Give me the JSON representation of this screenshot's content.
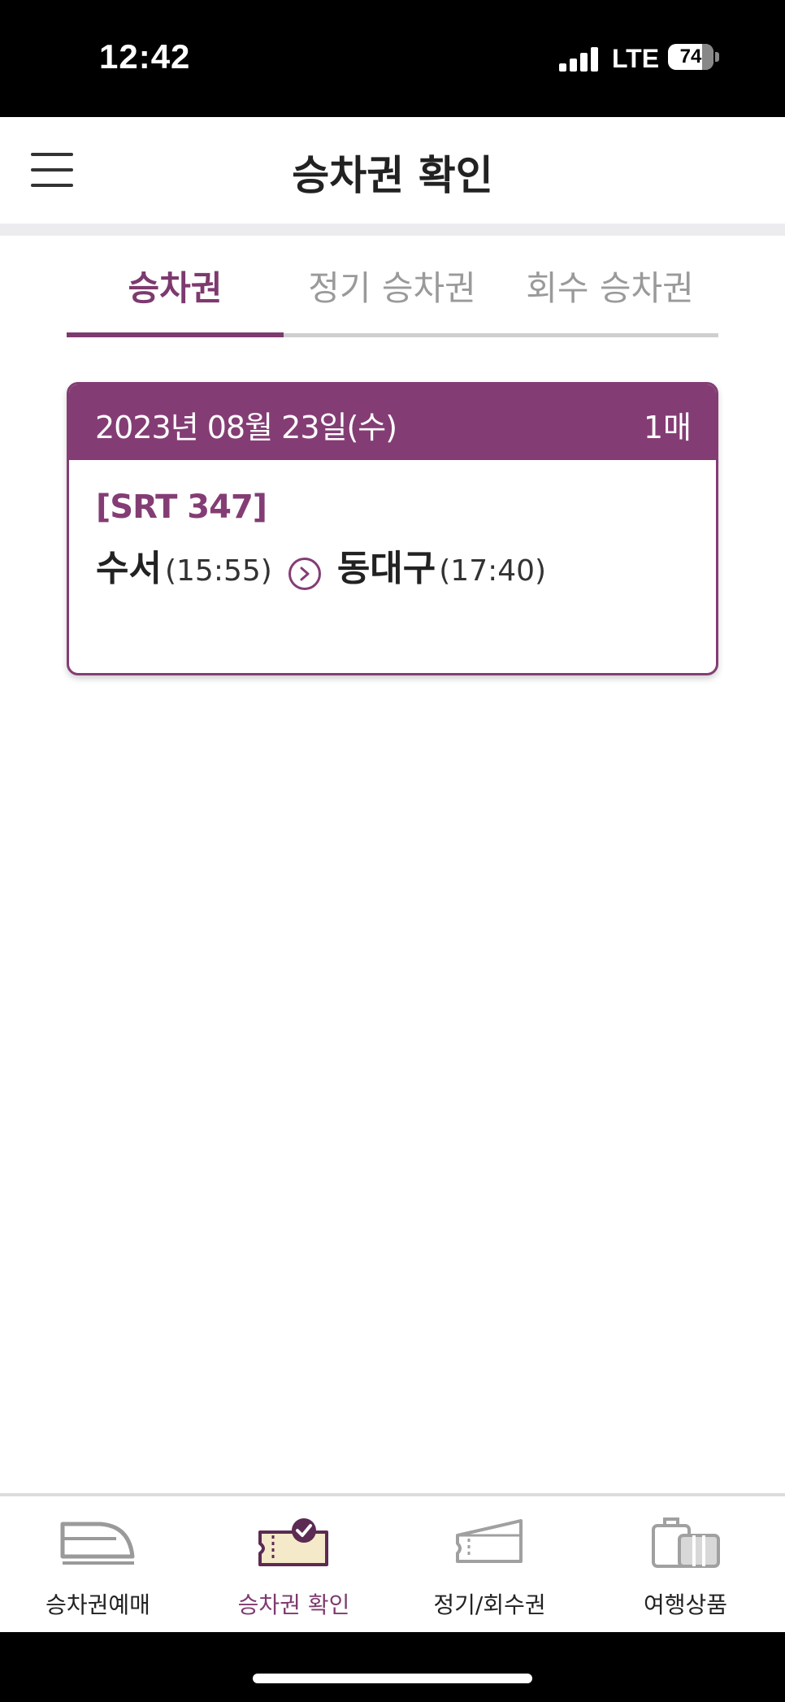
{
  "status_bar": {
    "time": "12:42",
    "network": "LTE",
    "battery": "74"
  },
  "header": {
    "title": "승차권 확인",
    "menu_icon": "hamburger-menu-icon"
  },
  "tabs": [
    {
      "label": "승차권",
      "active": true
    },
    {
      "label": "정기 승차권",
      "active": false
    },
    {
      "label": "회수 승차권",
      "active": false
    }
  ],
  "ticket": {
    "date": "2023년 08월 23일(수)",
    "count": "1매",
    "train": "[SRT 347]",
    "departure_station": "수서",
    "departure_time": "(15:55)",
    "arrival_station": "동대구",
    "arrival_time": "(17:40)",
    "arrow_icon": "chevron-right-circle-icon"
  },
  "bottom_nav": [
    {
      "label": "승차권예매",
      "icon": "train-icon",
      "active": false
    },
    {
      "label": "승차권 확인",
      "icon": "ticket-check-icon",
      "active": true
    },
    {
      "label": "정기/회수권",
      "icon": "season-ticket-icon",
      "active": false
    },
    {
      "label": "여행상품",
      "icon": "luggage-icon",
      "active": false
    }
  ],
  "colors": {
    "brand": "#843d74",
    "tab_active": "#7d3a6f",
    "tab_inactive": "#9a9a9a"
  }
}
